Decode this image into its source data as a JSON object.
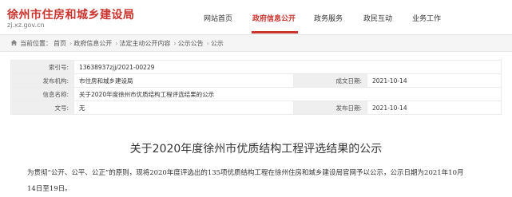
{
  "header": {
    "site_title": "徐州市住房和城乡建设局",
    "site_url": "zj.xz.gov.cn",
    "nav": [
      "网站首页",
      "政府信息公开",
      "政务服务",
      "政民互动",
      "业务工作"
    ],
    "active_nav_index": 1,
    "accent_color": "#c9342e"
  },
  "breadcrumb": {
    "label": "当前位置：",
    "items": [
      "首页",
      "政府信息公开",
      "法定主动公开内容",
      "公示公告",
      "公示"
    ],
    "icon": "home-icon"
  },
  "info": {
    "index_label": "索引号:",
    "index_value": "13638937zjj/2021-00229",
    "org_label": "发布机构:",
    "org_value": "市住房和城乡建设局",
    "date_label": "成文日期:",
    "date_value": "2021-10-14",
    "title_label": "信息名称:",
    "title_value": "关于2020年度徐州市优质结构工程评选结果的公示",
    "doc_label": "文号:",
    "doc_value": "无",
    "pub_label": "发布日期:",
    "pub_value": "2021-10-14"
  },
  "article": {
    "title": "关于2020年度徐州市优质结构工程评选结果的公示",
    "line1": "为贯彻“公开、公平、公正”的原则，现将2020年度评选出的135项优质结构工程在徐州住房和城乡建设局官网予以公示，公示日期为2021年10月",
    "line2": "14日至19日。"
  }
}
